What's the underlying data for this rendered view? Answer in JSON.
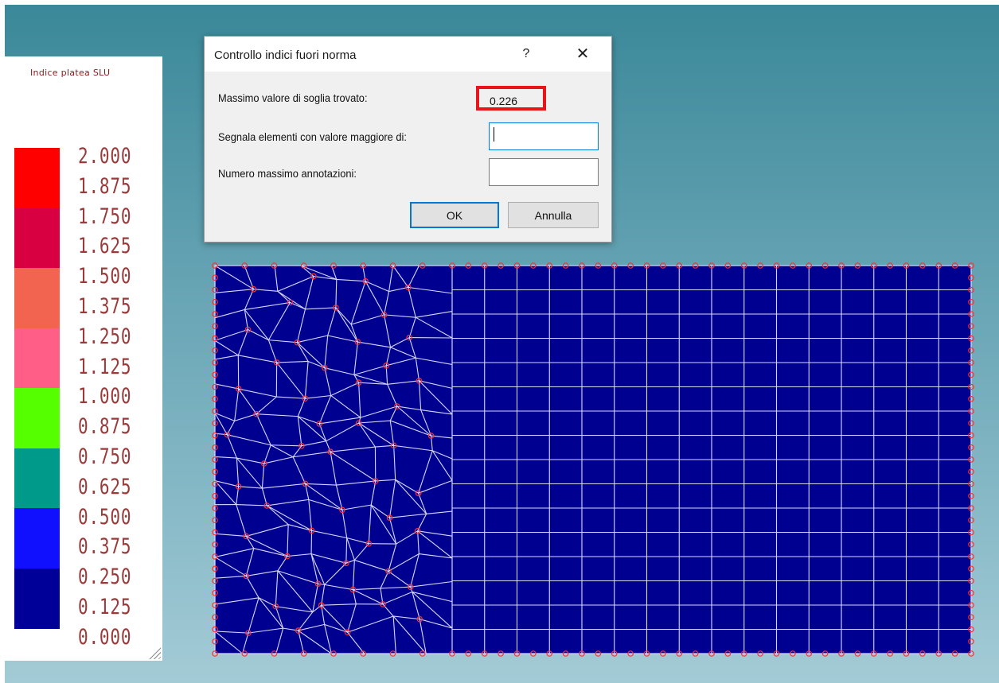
{
  "legend": {
    "title": "Indice platea SLU",
    "swatches": [
      {
        "color": "#ff0000"
      },
      {
        "color": "#d80040"
      },
      {
        "color": "#f26450"
      },
      {
        "color": "#ff5f87"
      },
      {
        "color": "#55ff00"
      },
      {
        "color": "#009a8a"
      },
      {
        "color": "#1010ff"
      },
      {
        "color": "#000099"
      }
    ],
    "values": [
      "2.000",
      "1.875",
      "1.750",
      "1.625",
      "1.500",
      "1.375",
      "1.250",
      "1.125",
      "1.000",
      "0.875",
      "0.750",
      "0.625",
      "0.500",
      "0.375",
      "0.250",
      "0.125",
      "0.000"
    ]
  },
  "mesh": {
    "fill_color": "#000090",
    "line_color": "#d8d8ff",
    "node_color": "#ff3030"
  },
  "dialog": {
    "title": "Controllo indici fuori norma",
    "help_label": "?",
    "close_label": "✕",
    "max_label": "Massimo valore di soglia trovato:",
    "max_value": "0.226",
    "highlight_color": "#e8141a",
    "threshold_label": "Segnala elementi con valore maggiore di:",
    "threshold_value": "",
    "max_annotations_label": "Numero massimo annotazioni:",
    "max_annotations_value": "",
    "ok_label": "OK",
    "cancel_label": "Annulla"
  }
}
